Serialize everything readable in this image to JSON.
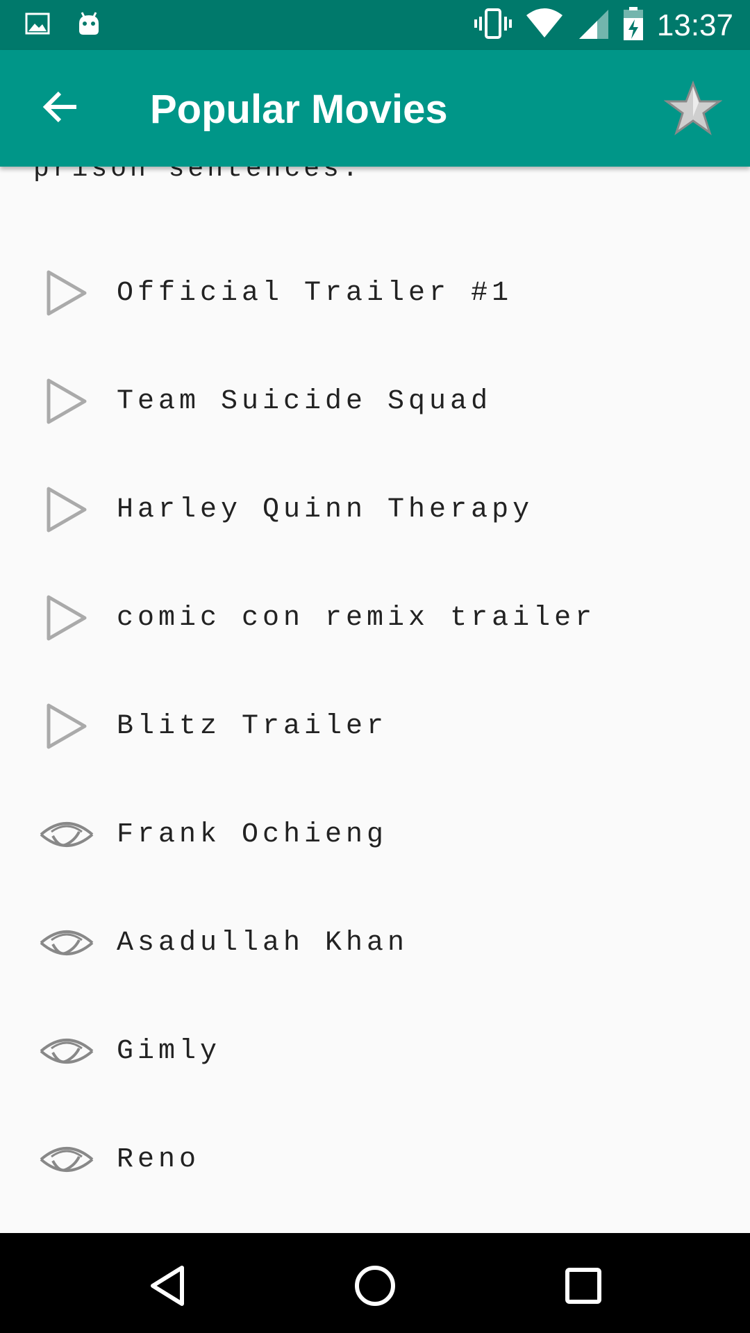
{
  "status_bar": {
    "time": "13:37",
    "icons": [
      "image-notification-icon",
      "android-notification-icon",
      "vibrate-icon",
      "wifi-icon",
      "cell-signal-icon",
      "battery-charging-icon"
    ]
  },
  "app_bar": {
    "title": "Popular Movies",
    "back_icon": "arrow-back-icon",
    "favorite_icon": "star-icon"
  },
  "overview_tail": "prison sentences.",
  "trailers": [
    {
      "label": "Official Trailer #1",
      "icon": "play-icon"
    },
    {
      "label": "Team Suicide Squad",
      "icon": "play-icon"
    },
    {
      "label": "Harley Quinn Therapy",
      "icon": "play-icon"
    },
    {
      "label": "comic con remix trailer",
      "icon": "play-icon"
    },
    {
      "label": "Blitz Trailer",
      "icon": "play-icon"
    }
  ],
  "reviews": [
    {
      "label": "Frank Ochieng",
      "icon": "eye-icon"
    },
    {
      "label": "Asadullah Khan",
      "icon": "eye-icon"
    },
    {
      "label": "Gimly",
      "icon": "eye-icon"
    },
    {
      "label": "Reno",
      "icon": "eye-icon"
    }
  ],
  "colors": {
    "status_bar": "#00796b",
    "app_bar": "#009688",
    "background": "#fafafa",
    "icon_gray": "#aaaaaa"
  }
}
